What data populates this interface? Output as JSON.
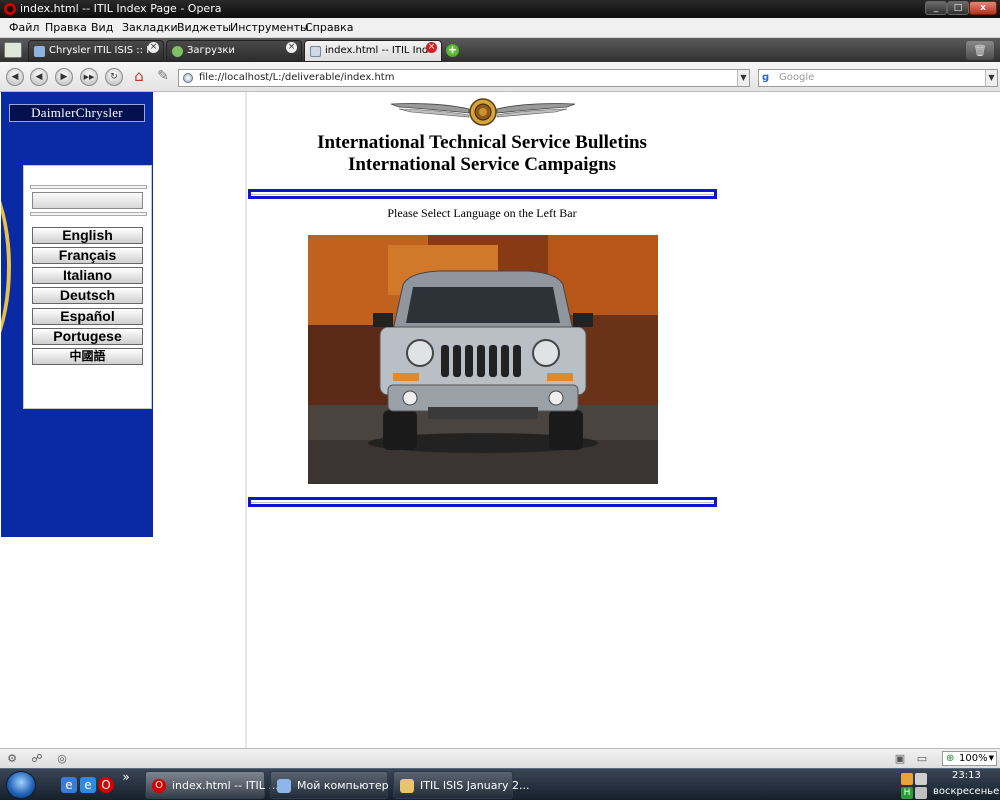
{
  "window": {
    "title": "index.html -- ITIL Index Page - Opera",
    "controls": {
      "minimize": "_",
      "maximize": "□",
      "close": "x"
    }
  },
  "menu": [
    "Файл",
    "Правка",
    "Вид",
    "Закладки",
    "Виджеты",
    "Инструменты",
    "Справка"
  ],
  "tabs": [
    {
      "label": "Chrysler ITIL ISIS :: RuT...",
      "close": "×"
    },
    {
      "label": "Загрузки",
      "close": "×"
    },
    {
      "label": "index.html -- ITIL Inde...",
      "close": "×"
    }
  ],
  "new_tab": "+",
  "address": {
    "url": "file://localhost/L:/deliverable/index.htm",
    "dropdown": "▼"
  },
  "search": {
    "engine": "g",
    "placeholder": "Google",
    "dropdown": "▼"
  },
  "nav": {
    "back": "◀",
    "forward": "◀",
    "play": "▶",
    "fast_forward": "▶▶",
    "reload": "↻",
    "home": "⌂",
    "wand": "✎"
  },
  "sidebar": {
    "logo": "DaimlerChrysler",
    "languages": [
      "English",
      "Français",
      "Italiano",
      "Deutsch",
      "Español",
      "Portugese",
      "中國語"
    ]
  },
  "content": {
    "title_line1": "International Technical Service Bulletins",
    "title_line2": "International Service Campaigns",
    "instruction": "Please Select Language on the Left Bar"
  },
  "statusbar": {
    "zoom": "100%"
  },
  "taskbar": {
    "tasks": [
      {
        "label": "index.html -- ITIL ..."
      },
      {
        "label": "Мой компьютер"
      },
      {
        "label": "ITIL ISIS January 2..."
      }
    ],
    "overflow": "»",
    "clock_time": "23:13",
    "clock_day": "воскресенье"
  },
  "colors": {
    "sidebar_bg": "#0a2aa4",
    "rule_blue": "#0a16d4",
    "logo_bg": "#04114f",
    "swoosh_gold": "#e7c24a"
  }
}
